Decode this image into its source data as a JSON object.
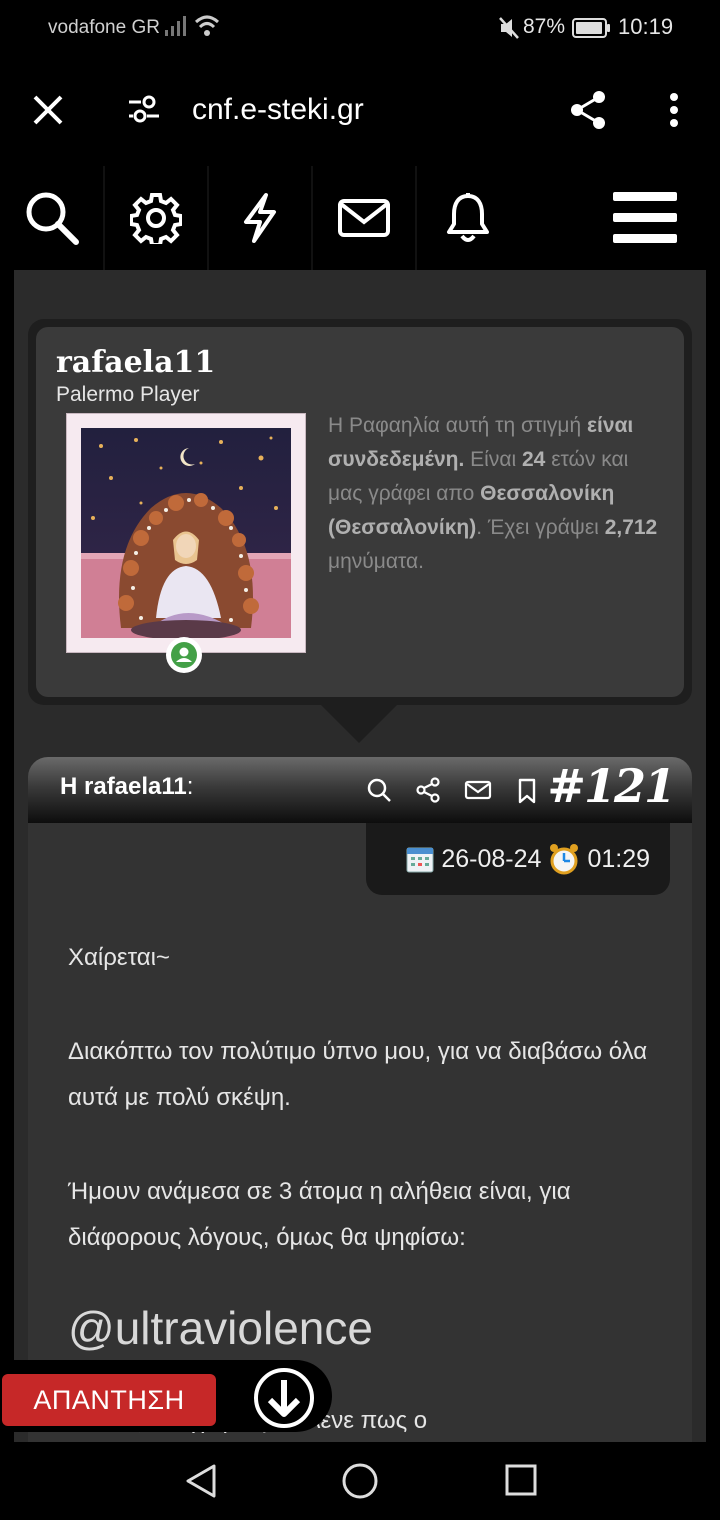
{
  "status_bar": {
    "carrier": "vodafone GR",
    "battery_percent": "87%",
    "time": "10:19",
    "icons": [
      "signal-icon",
      "wifi-icon",
      "mute-icon",
      "battery-icon"
    ]
  },
  "browser": {
    "url": "cnf.e-steki.gr",
    "icons": [
      "close-icon",
      "site-settings-icon",
      "share-icon",
      "more-vertical-icon"
    ]
  },
  "toolbar": {
    "icons": [
      "search-icon",
      "gear-icon",
      "lightning-icon",
      "mail-icon",
      "bell-icon",
      "menu-icon"
    ]
  },
  "profile": {
    "username": "rafaela11",
    "rank": "Palermo Player",
    "online_status_icon": "user-online-icon",
    "bio": {
      "part1": "Η Ραφαηλία αυτή τη στιγμή ",
      "online_text": "είναι συνδεδεμένη.",
      "part2": " Είναι ",
      "age": "24",
      "part3": " ετών και μας γράφει απο ",
      "location": "Θεσσαλονίκη (Θεσσαλονίκη)",
      "part4": ". Έχει γράψει ",
      "message_count": "2,712",
      "part5": " μηνύματα."
    }
  },
  "post": {
    "author_label": "Η rafaela11",
    "author_suffix": ":",
    "number": "#121",
    "date": "26-08-24",
    "time": "01:29",
    "action_icons": [
      "search-icon",
      "share-icon",
      "mail-icon",
      "bookmark-icon"
    ],
    "paragraphs": [
      "Χαίρεται~",
      "Διακόπτω τον πολύτιμο ύπνο μου, για να διαβάσω όλα αυτά με πολύ σκέψη.",
      "Ήμουν ανάμεσα σε 3 άτομα η αλήθεια είναι, για διάφορους λόγους, όμως θα ψηφίσω:"
    ],
    "mention": "@ultraviolence",
    "cut_text": "Καθώς στο χωριό μου λένε πως ο"
  },
  "floating": {
    "reply_label": "ΑΠΑΝΤΗΣΗ",
    "scroll_icon": "arrow-down-circle-icon"
  },
  "nav": {
    "icons": [
      "back-icon",
      "home-icon",
      "recents-icon"
    ]
  }
}
